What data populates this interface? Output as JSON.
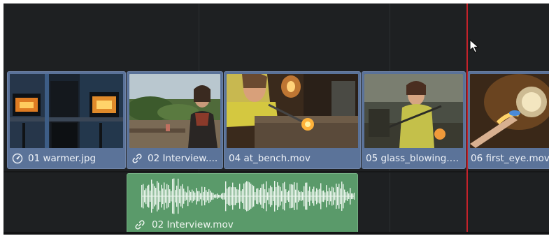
{
  "timeline": {
    "video_clips": [
      {
        "name": "01 warmer.jpg",
        "icon": "speedometer-icon"
      },
      {
        "name": "02 Interview....",
        "icon": "link-icon"
      },
      {
        "name": "04 at_bench.mov",
        "icon": ""
      },
      {
        "name": "05 glass_blowing.m...",
        "icon": ""
      },
      {
        "name": "06 first_eye.mov",
        "icon": ""
      }
    ],
    "audio_clip": {
      "name": "02 Interview.mov",
      "icon": "link-icon"
    }
  },
  "colors": {
    "video_clip": "#5b7399",
    "audio_clip": "#5a9a6a",
    "playhead": "#c4222a",
    "background": "#1e2022"
  }
}
